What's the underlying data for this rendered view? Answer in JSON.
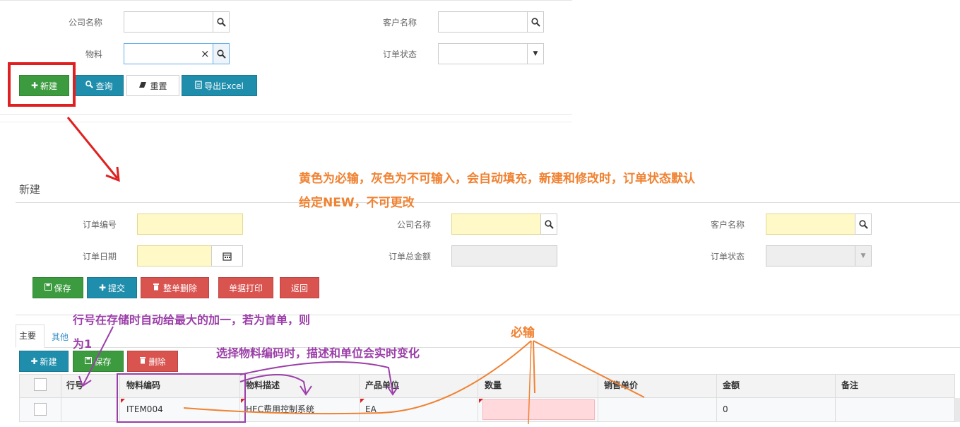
{
  "search_panel": {
    "company_label": "公司名称",
    "customer_label": "客户名称",
    "material_label": "物料",
    "order_status_label": "订单状态",
    "material_clear": "×",
    "buttons": {
      "new": "新建",
      "query": "查询",
      "reset": "重置",
      "export": "导出Excel"
    }
  },
  "form": {
    "title": "新建",
    "order_no_label": "订单编号",
    "company_label": "公司名称",
    "customer_label": "客户名称",
    "order_date_label": "订单日期",
    "order_total_label": "订单总金额",
    "order_status_label": "订单状态",
    "buttons": {
      "save": "保存",
      "submit": "提交",
      "delete_all": "整单删除",
      "print": "单据打印",
      "back": "返回"
    }
  },
  "tabs": [
    "主要",
    "其他"
  ],
  "grid_toolbar": {
    "new": "新建",
    "save": "保存",
    "delete": "删除"
  },
  "table": {
    "columns": [
      "行号",
      "物料编码",
      "物料描述",
      "产品单位",
      "数量",
      "销售单价",
      "金额",
      "备注"
    ],
    "rows": [
      {
        "line_no": "",
        "material_code": "ITEM004",
        "material_desc": "HEC费用控制系统",
        "unit": "EA",
        "qty": "",
        "unit_price": "",
        "amount": "0",
        "remark": ""
      }
    ]
  },
  "annotations": {
    "note1_line1": "黄色为必输，灰色为不可输入，会自动填充，新建和修改时，订单状态默认",
    "note1_line2": "给定NEW，不可更改",
    "note2_line1": "行号在存储时自动给最大的加一，若为首单，则",
    "note2_line2": "为1",
    "note3": "选择物料编码时，描述和单位会实时变化",
    "note4": "必输"
  },
  "colors": {
    "required_yellow": "#fff9c8",
    "readonly_gray": "#eeeeee",
    "annotation_orange": "#f08232",
    "annotation_purple": "#9b3fa8",
    "highlight_red": "#e02020"
  }
}
